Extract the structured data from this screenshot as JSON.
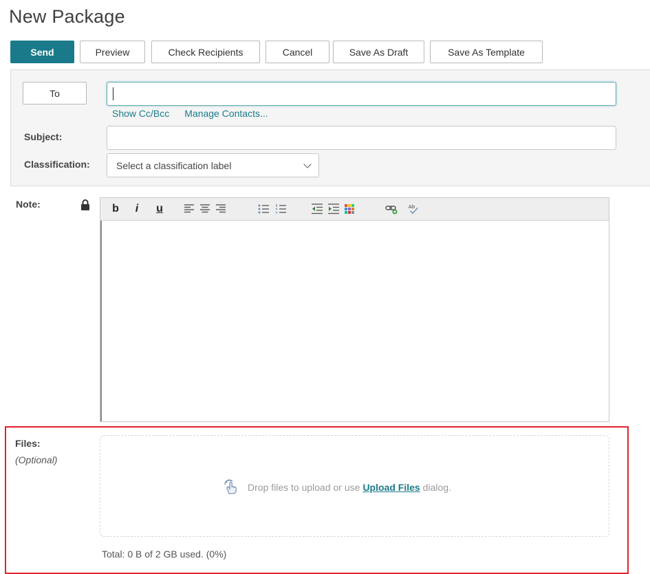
{
  "page": {
    "title": "New Package"
  },
  "toolbar": {
    "send_label": "Send",
    "preview_label": "Preview",
    "check_recipients_label": "Check Recipients",
    "cancel_label": "Cancel",
    "save_draft_label": "Save As Draft",
    "save_template_label": "Save As Template"
  },
  "header": {
    "to_label": "To",
    "to_value": "",
    "show_cc_bcc_label": "Show Cc/Bcc",
    "manage_contacts_label": "Manage Contacts...",
    "subject_label": "Subject:",
    "subject_value": "",
    "classification_label": "Classification:",
    "classification_placeholder": "Select a classification label"
  },
  "note": {
    "label": "Note:",
    "lock_icon": "lock-icon",
    "toolbar_icons": {
      "bold": "b",
      "italic": "i",
      "underline": "u",
      "spellcheck": "spellcheck-icon"
    }
  },
  "files": {
    "label": "Files:",
    "optional_label": "(Optional)",
    "drop_text_before": "Drop files to upload or use",
    "upload_link_label": "Upload Files",
    "drop_text_after": "dialog.",
    "usage_text": "Total: 0 B of 2 GB used. (0%)"
  },
  "colors": {
    "primary": "#1a7a8a",
    "highlight_frame": "#e0222b"
  }
}
